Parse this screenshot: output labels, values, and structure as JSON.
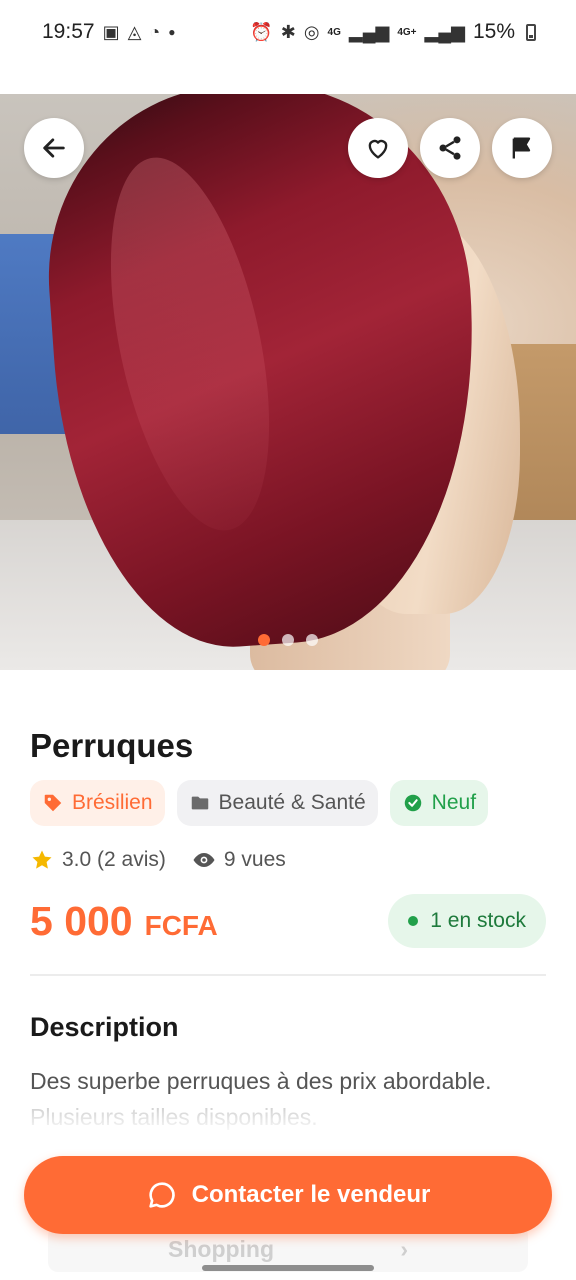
{
  "status_bar": {
    "time": "19:57",
    "left_icons": [
      "image-icon",
      "drive-icon",
      "whatsapp-icon",
      "dot-icon"
    ],
    "right_icons": [
      "alarm-icon",
      "bluetooth-icon",
      "hotspot-icon",
      "signal-icon",
      "signal-icon"
    ],
    "net_label_1": "4G",
    "net_label_2": "4G+",
    "battery": "15%"
  },
  "hero": {
    "image_alt": "Burgundy bob wig on mannequin head",
    "dots_count": 3,
    "active_dot": 0
  },
  "product": {
    "title": "Perruques",
    "tags": [
      {
        "label": "Brésilien",
        "icon": "tag-icon",
        "style": "orange"
      },
      {
        "label": "Beauté & Santé",
        "icon": "folder-icon",
        "style": "gray"
      },
      {
        "label": "Neuf",
        "icon": "check-circle-icon",
        "style": "green"
      }
    ],
    "rating": "3.0 (2 avis)",
    "views": "9 vues",
    "price_amount": "5 000",
    "price_currency": "FCFA",
    "stock": "1 en stock"
  },
  "description": {
    "title": "Description",
    "line1": "Des superbe perruques à des prix abordable.",
    "line2": "Plusieurs tailles disponibles."
  },
  "footer": {
    "cta_label": "Contacter le vendeur",
    "ghost_label": "Shopping"
  },
  "colors": {
    "accent": "#ff6b35",
    "green": "#21a04a",
    "star": "#f5b800"
  }
}
